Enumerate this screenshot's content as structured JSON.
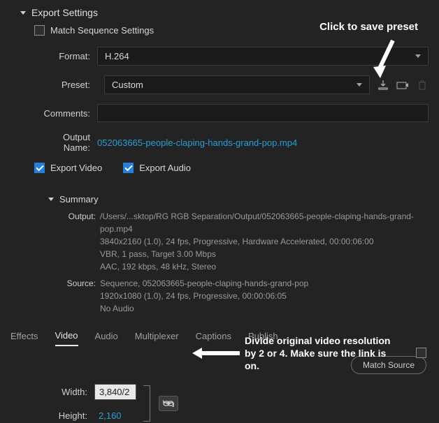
{
  "section": {
    "title": "Export Settings"
  },
  "matchSequence": {
    "label": "Match Sequence Settings",
    "checked": false
  },
  "fields": {
    "formatLabel": "Format:",
    "formatValue": "H.264",
    "presetLabel": "Preset:",
    "presetValue": "Custom",
    "commentsLabel": "Comments:",
    "commentsValue": "",
    "outputNameLabel": "Output Name:",
    "outputNameValue": "052063665-people-claping-hands-grand-pop.mp4"
  },
  "exportChecks": {
    "videoLabel": "Export Video",
    "videoChecked": true,
    "audioLabel": "Export Audio",
    "audioChecked": true
  },
  "summary": {
    "title": "Summary",
    "output": {
      "key": "Output:",
      "lines": [
        "/Users/...sktop/RG RGB Separation/Output/052063665-people-claping-hands-grand-pop.mp4",
        "3840x2160 (1.0), 24 fps, Progressive, Hardware Accelerated, 00:00:06:00",
        "VBR, 1 pass, Target 3.00 Mbps",
        "AAC, 192 kbps, 48 kHz, Stereo"
      ]
    },
    "source": {
      "key": "Source:",
      "lines": [
        "Sequence, 052063665-people-claping-hands-grand-pop",
        "1920x1080 (1.0), 24 fps, Progressive, 00:00:06:05",
        "No Audio"
      ]
    }
  },
  "tabs": {
    "items": [
      "Effects",
      "Video",
      "Audio",
      "Multiplexer",
      "Captions",
      "Publish"
    ],
    "active": "Video"
  },
  "matchSourceBtn": "Match Source",
  "dimensions": {
    "widthLabel": "Width:",
    "widthValue": "3,840/2",
    "heightLabel": "Height:",
    "heightValue": "2,160"
  },
  "annotations": {
    "savePreset": "Click to save preset",
    "divide": "Divide original video resolution by 2 or 4. Make sure the link is on."
  }
}
